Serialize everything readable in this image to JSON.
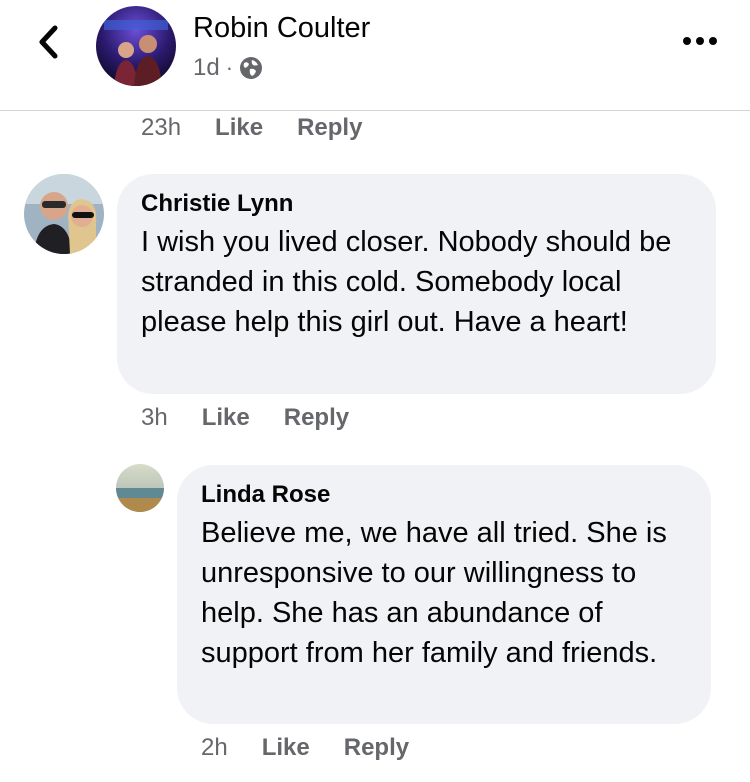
{
  "header": {
    "name": "Robin Coulter",
    "time": "1d",
    "separator": "·",
    "back_icon": "chevron-left-icon",
    "visibility_icon": "globe-icon",
    "more_icon": "more-horizontal-icon"
  },
  "parent_actions": {
    "time": "23h",
    "like": "Like",
    "reply": "Reply"
  },
  "comments": [
    {
      "author": "Christie Lynn",
      "text": "I wish you lived closer. Nobody should be stranded in this cold. Somebody local please help this girl out. Have a heart!",
      "time": "3h",
      "like": "Like",
      "reply": "Reply"
    },
    {
      "author": "Linda Rose",
      "text": "Believe me, we have all tried. She is unresponsive to our willingness to help. She has an abundance of support from her family and friends.",
      "time": "2h",
      "like": "Like",
      "reply": "Reply"
    }
  ],
  "colors": {
    "bubble": "#f0f2f5",
    "secondary_text": "#65676b",
    "primary_text": "#050505"
  }
}
